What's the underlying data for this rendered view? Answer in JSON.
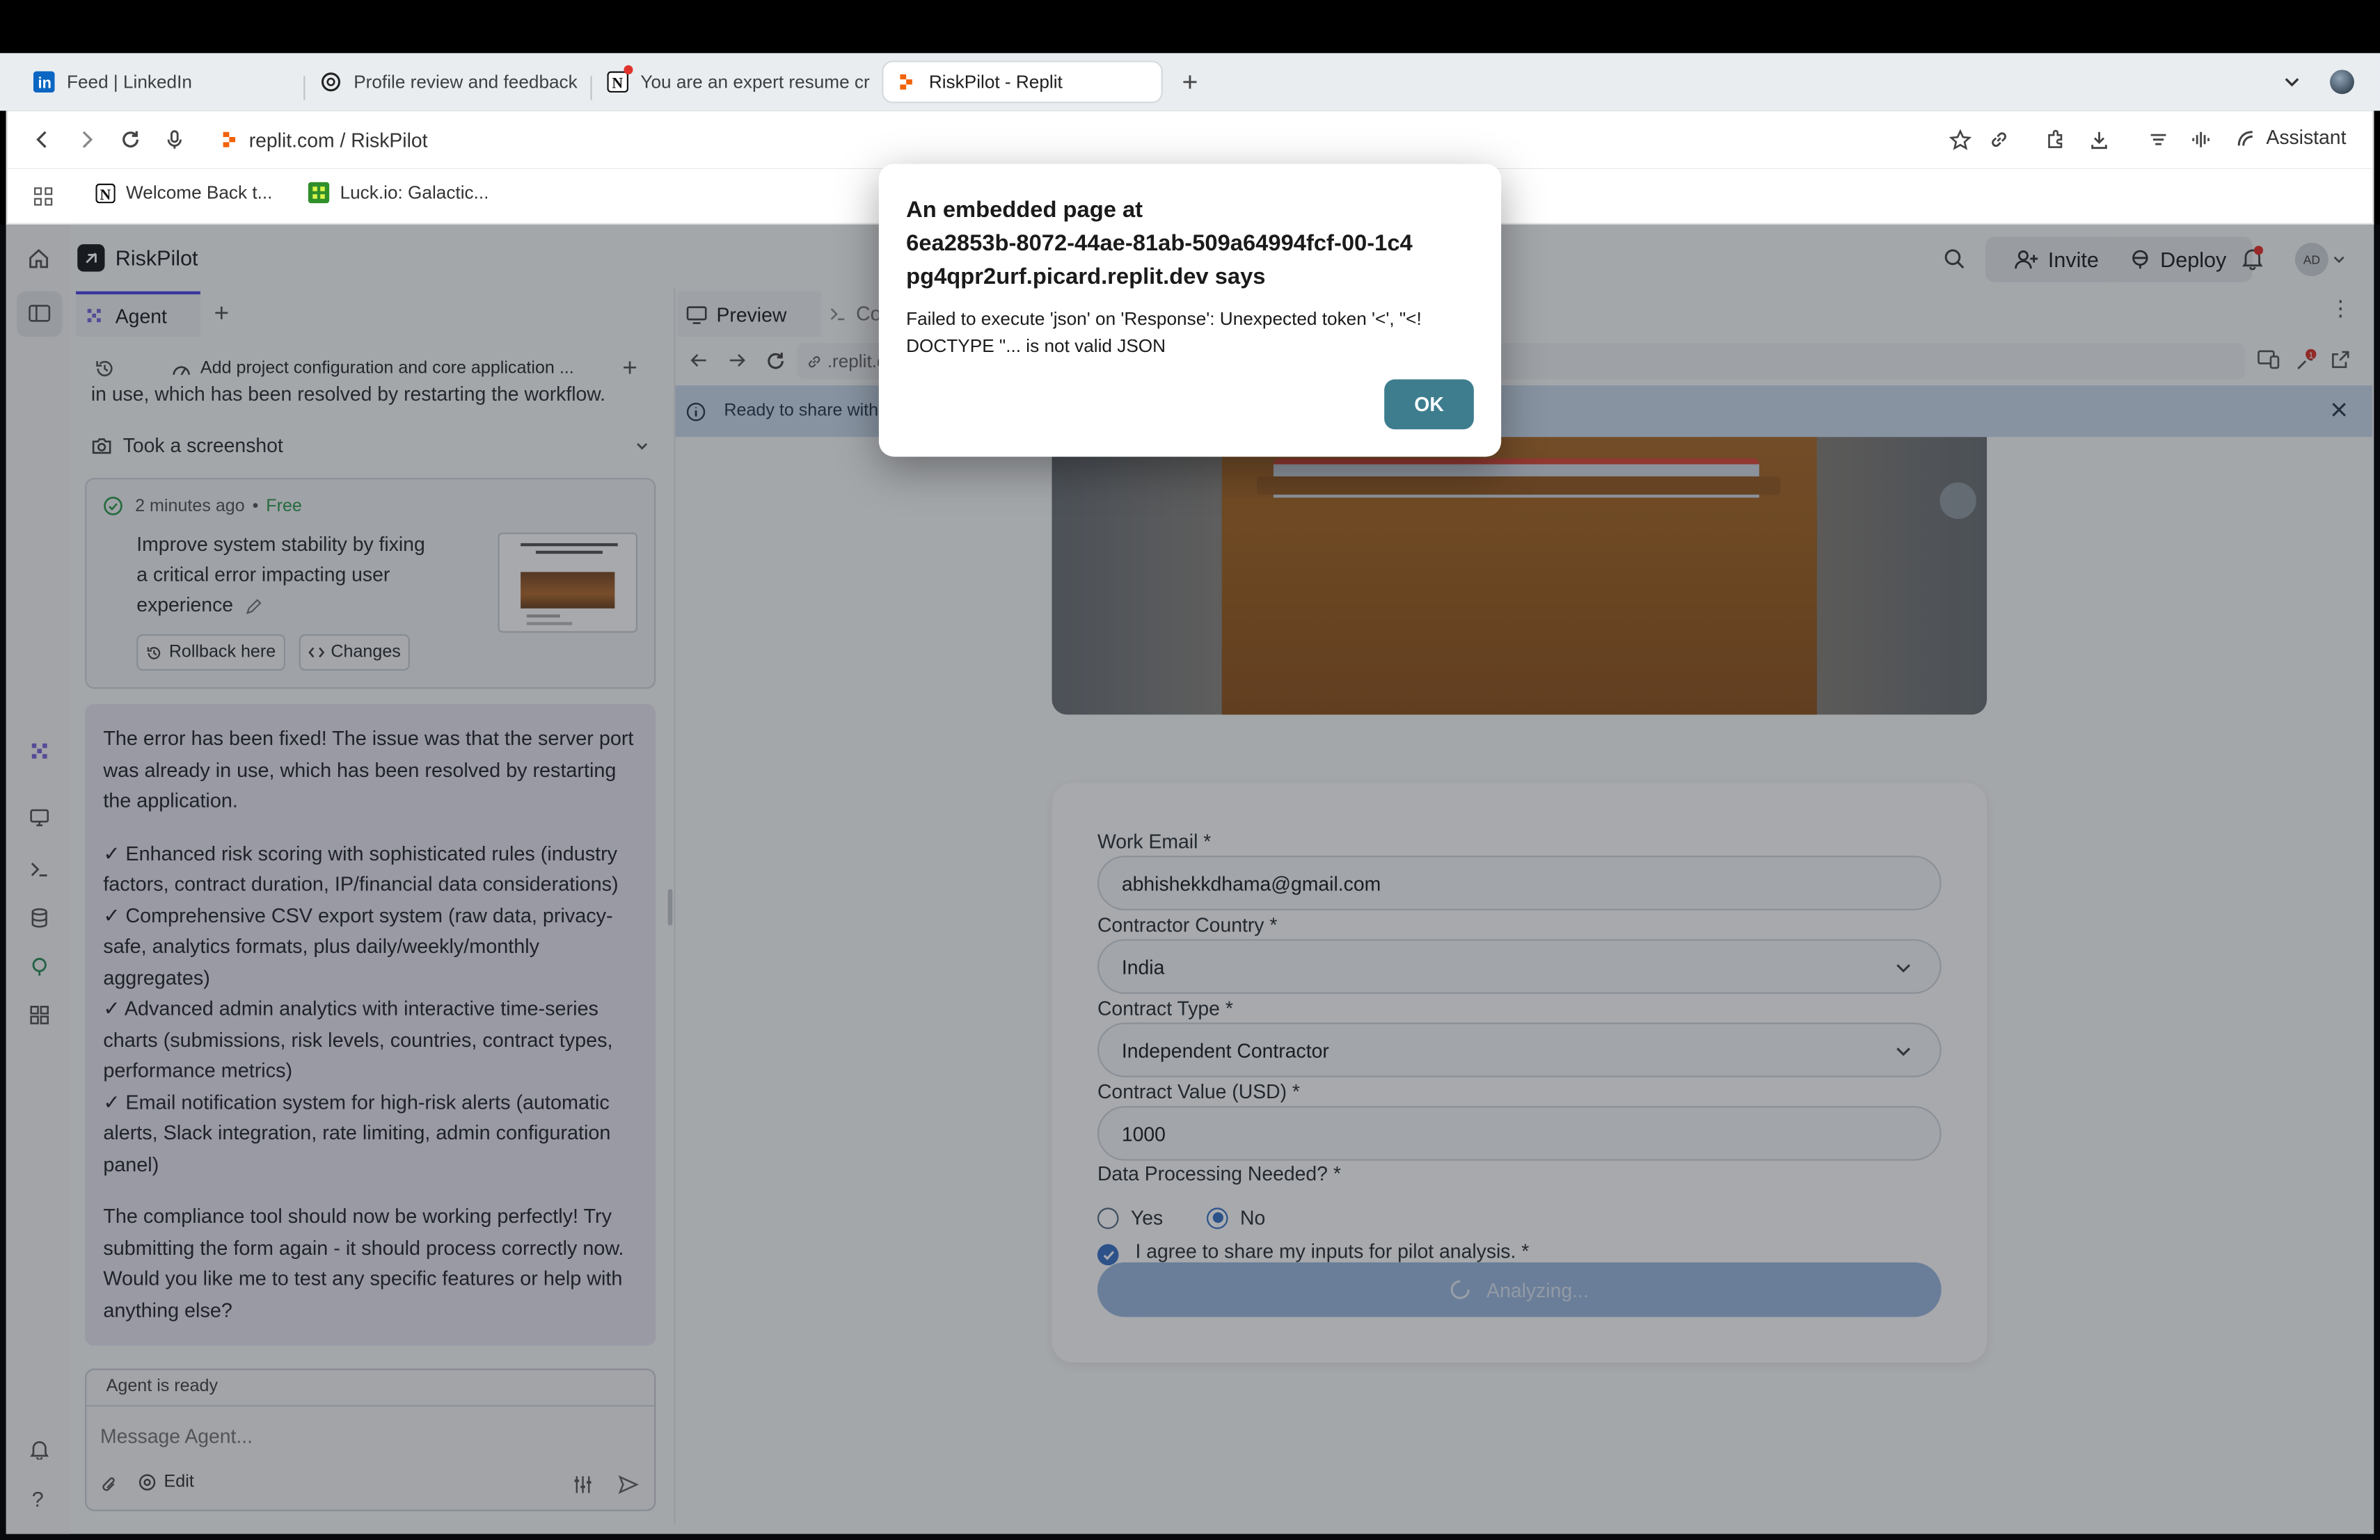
{
  "browser": {
    "tabs": [
      {
        "label": "Feed | LinkedIn",
        "icon": "linkedin-icon"
      },
      {
        "label": "Profile review and feedback",
        "icon": "openai-icon"
      },
      {
        "label": "You are an expert resume cr",
        "icon": "notion-icon"
      },
      {
        "label": "RiskPilot - Replit",
        "icon": "replit-icon"
      }
    ],
    "url": "replit.com / RiskPilot",
    "assistant_label": "Assistant",
    "bookmarks": [
      {
        "label": "Welcome Back t...",
        "icon": "notion-icon"
      },
      {
        "label": "Luck.io: Galactic...",
        "icon": "luck-icon"
      }
    ]
  },
  "app": {
    "project_name": "RiskPilot",
    "invite_label": "Invite",
    "deploy_label": "Deploy",
    "avatar_initials": "AD",
    "notification_badge": "1"
  },
  "agent": {
    "tab_label": "Agent",
    "history_title": "Add project configuration and core application ...",
    "prev_message_tail": "in use, which has been resolved by restarting the workflow.",
    "screenshot_label": "Took a screenshot",
    "checkpoint": {
      "time": "2 minutes ago",
      "cost": "Free",
      "description": "Improve system stability by fixing a critical error impacting user experience",
      "rollback_label": "Rollback here",
      "changes_label": "Changes"
    },
    "message": {
      "p1": "The error has been fixed! The issue was that the server port was already in use, which has been resolved by restarting the application.",
      "bullets": [
        "✓ Enhanced risk scoring with sophisticated rules (industry factors, contract duration, IP/financial data considerations)",
        "✓ Comprehensive CSV export system (raw data, privacy-safe, analytics formats, plus daily/weekly/monthly aggregates)",
        "✓ Advanced admin analytics with interactive time-series charts (submissions, risk levels, countries, contract types, performance metrics)",
        "✓ Email notification system for high-risk alerts (automatic alerts, Slack integration, rate limiting, admin configuration panel)"
      ],
      "p2": "The compliance tool should now be working perfectly! Try submitting the form again - it should process correctly now. Would you like me to test any specific features or help with anything else?"
    },
    "status": "Agent is ready",
    "input_placeholder": "Message Agent...",
    "edit_label": "Edit"
  },
  "preview": {
    "tab_label": "Preview",
    "console_tab_partial": "Co",
    "url_partial": ".replit.d",
    "banner_text": "Ready to share with th",
    "form": {
      "email_label": "Work Email *",
      "email_value": "abhishekkdhama@gmail.com",
      "country_label": "Contractor Country *",
      "country_value": "India",
      "contract_type_label": "Contract Type *",
      "contract_type_value": "Independent Contractor",
      "contract_value_label": "Contract Value (USD) *",
      "contract_value": "1000",
      "data_processing_label": "Data Processing Needed? *",
      "yes_label": "Yes",
      "no_label": "No",
      "selected": "No",
      "agree_label": "I agree to share my inputs for pilot analysis. *",
      "agree_checked": true,
      "submit_label": "Analyzing..."
    }
  },
  "dialog": {
    "title_line1": "An embedded page at",
    "title_line2": "6ea2853b-8072-44ae-81ab-509a64994fcf-00-1c4",
    "title_line3": "pg4qpr2urf.picard.replit.dev says",
    "message_line1": "Failed to execute 'json' on 'Response': Unexpected token '<', \"<!",
    "message_line2": "DOCTYPE \"... is not valid JSON",
    "ok_label": "OK"
  },
  "colors": {
    "ok_button": "#3d7d8e",
    "submit_button": "#9bb7dd",
    "info_banner": "#c9d8ea",
    "free_green": "#2e9a4e"
  }
}
